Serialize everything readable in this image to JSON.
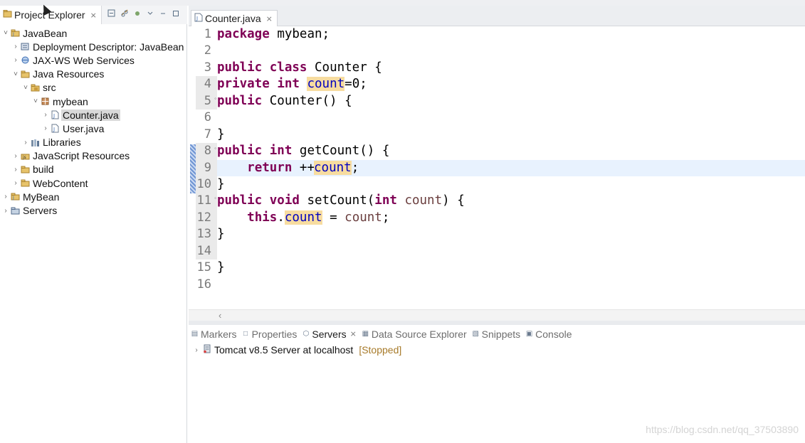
{
  "explorer": {
    "title": "Project Explorer",
    "close": "⨯",
    "tree": [
      {
        "label": "JavaBean",
        "twisty": "˅",
        "icon": "java-project-icon",
        "depth": 0
      },
      {
        "label": "Deployment Descriptor: JavaBean",
        "twisty": "›",
        "icon": "deployment-descriptor-icon",
        "depth": 1
      },
      {
        "label": "JAX-WS Web Services",
        "twisty": "›",
        "icon": "web-services-icon",
        "depth": 1
      },
      {
        "label": "Java Resources",
        "twisty": "˅",
        "icon": "java-resources-icon",
        "depth": 1
      },
      {
        "label": "src",
        "twisty": "˅",
        "icon": "source-folder-icon",
        "depth": 2
      },
      {
        "label": "mybean",
        "twisty": "˅",
        "icon": "package-icon",
        "depth": 3
      },
      {
        "label": "Counter.java",
        "twisty": "›",
        "icon": "java-file-icon",
        "depth": 4,
        "selected": true
      },
      {
        "label": "User.java",
        "twisty": "›",
        "icon": "java-file-icon",
        "depth": 4
      },
      {
        "label": "Libraries",
        "twisty": "›",
        "icon": "libraries-icon",
        "depth": 2
      },
      {
        "label": "JavaScript Resources",
        "twisty": "›",
        "icon": "javascript-resources-icon",
        "depth": 1
      },
      {
        "label": "build",
        "twisty": "›",
        "icon": "folder-icon",
        "depth": 1
      },
      {
        "label": "WebContent",
        "twisty": "›",
        "icon": "folder-icon",
        "depth": 1
      },
      {
        "label": "MyBean",
        "twisty": "›",
        "icon": "java-project-icon",
        "depth": 0
      },
      {
        "label": "Servers",
        "twisty": "›",
        "icon": "servers-folder-icon",
        "depth": 0
      }
    ]
  },
  "editor": {
    "tab_label": "Counter.java",
    "close": "⨯",
    "current_line": 9,
    "lines": [
      {
        "n": "1",
        "tokens": [
          [
            "kw",
            "package"
          ],
          [
            "",
            "mybean;"
          ]
        ]
      },
      {
        "n": "2",
        "tokens": []
      },
      {
        "n": "3",
        "tokens": [
          [
            "kw",
            "public"
          ],
          [
            "",
            ""
          ],
          [
            "kw",
            "class"
          ],
          [
            "",
            "Counter {"
          ]
        ]
      },
      {
        "n": "4",
        "tokens": [
          [
            "kw",
            "private"
          ],
          [
            "",
            ""
          ],
          [
            "kw",
            "int"
          ],
          [
            "",
            ""
          ],
          [
            "fld occ",
            "count"
          ],
          [
            "",
            "=0;"
          ]
        ]
      },
      {
        "n": "5",
        "fold": true,
        "tokens": [
          [
            "kw",
            "public"
          ],
          [
            "",
            "Counter() {"
          ]
        ]
      },
      {
        "n": "6",
        "tokens": []
      },
      {
        "n": "7",
        "tokens": [
          [
            "",
            "}"
          ]
        ]
      },
      {
        "n": "8",
        "fold": true,
        "tokens": [
          [
            "kw",
            "public"
          ],
          [
            "",
            ""
          ],
          [
            "kw",
            "int"
          ],
          [
            "",
            "getCount() {"
          ]
        ]
      },
      {
        "n": "9",
        "tokens": [
          [
            "",
            "    "
          ],
          [
            "kw",
            "return"
          ],
          [
            "",
            "++"
          ],
          [
            "caret",
            ""
          ],
          [
            "fld occ",
            "count"
          ],
          [
            "",
            ";"
          ]
        ]
      },
      {
        "n": "10",
        "tokens": [
          [
            "",
            "}"
          ]
        ]
      },
      {
        "n": "11",
        "fold": true,
        "tokens": [
          [
            "kw",
            "public"
          ],
          [
            "",
            ""
          ],
          [
            "kw",
            "void"
          ],
          [
            "",
            "setCount("
          ],
          [
            "kw",
            "int"
          ],
          [
            "",
            ""
          ],
          [
            "var",
            "count"
          ],
          [
            "",
            ") {"
          ]
        ]
      },
      {
        "n": "12",
        "tokens": [
          [
            "",
            "    "
          ],
          [
            "kw",
            "this"
          ],
          [
            ".",
            ""
          ],
          [
            "fld occ",
            "count"
          ],
          [
            "",
            " = "
          ],
          [
            "var",
            "count"
          ],
          [
            "",
            ";"
          ]
        ]
      },
      {
        "n": "13",
        "tokens": [
          [
            "",
            "}"
          ]
        ]
      },
      {
        "n": "14",
        "tokens": []
      },
      {
        "n": "15",
        "tokens": [
          [
            "",
            "}"
          ]
        ]
      },
      {
        "n": "16",
        "tokens": []
      }
    ]
  },
  "scroll_left": "‹",
  "views": {
    "tabs": [
      {
        "label": "Markers",
        "icon": "markers-icon",
        "glyph": "▤"
      },
      {
        "label": "Properties",
        "icon": "properties-icon",
        "glyph": "□"
      },
      {
        "label": "Servers",
        "icon": "servers-icon",
        "glyph": "⬡",
        "active": true,
        "close": "⨯"
      },
      {
        "label": "Data Source Explorer",
        "icon": "data-source-icon",
        "glyph": "▦"
      },
      {
        "label": "Snippets",
        "icon": "snippets-icon",
        "glyph": "▧"
      },
      {
        "label": "Console",
        "icon": "console-icon",
        "glyph": "▣"
      }
    ],
    "server": {
      "name": "Tomcat v8.5 Server at localhost",
      "status": "[Stopped]"
    }
  },
  "watermark": "https://blog.csdn.net/qq_37503890",
  "colors": {
    "keyword": "#7f0055",
    "field": "#0000c0",
    "local_var": "#6a3e3e",
    "occurrence": "#f7dca0",
    "current_line": "#e8f2fe"
  }
}
